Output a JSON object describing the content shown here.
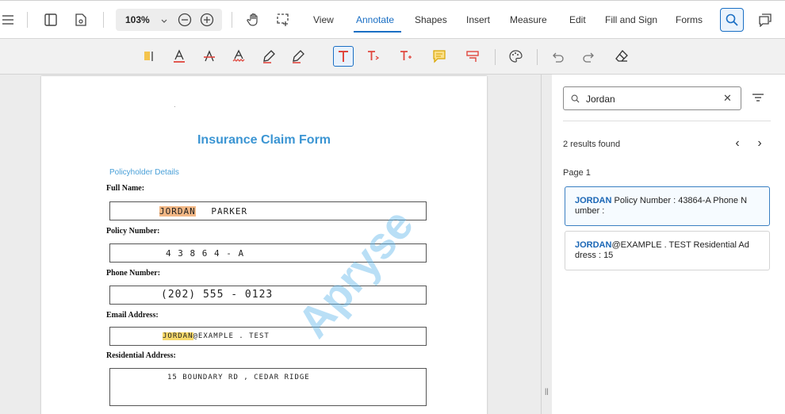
{
  "toolbar": {
    "zoom": "103%",
    "tabs": [
      {
        "label": "View"
      },
      {
        "label": "Annotate"
      },
      {
        "label": "Shapes"
      },
      {
        "label": "Insert"
      },
      {
        "label": "Measure"
      },
      {
        "label": "Edit"
      },
      {
        "label": "Fill and Sign"
      },
      {
        "label": "Forms"
      }
    ],
    "active_tab": "Annotate",
    "accent_color": "#1a6fc4"
  },
  "annotate_tools": [
    "highlight-area-icon",
    "underline-text-icon",
    "strikeout-text-icon",
    "squiggly-text-icon",
    "freehand-icon",
    "freehand-highlight-icon",
    "free-text-icon",
    "callout-icon",
    "add-text-icon",
    "note-icon",
    "link-annotation-icon",
    "style-palette-icon",
    "undo-icon",
    "redo-icon",
    "eraser-icon"
  ],
  "document": {
    "title": "Insurance Claim Form",
    "section": "Policyholder Details",
    "fields": [
      {
        "label": "Full Name:",
        "value_hl": "JORDAN",
        "value_rest": "PARKER"
      },
      {
        "label": "Policy Number:",
        "value": "4 3 8 6 4 - A"
      },
      {
        "label": "Phone Number:",
        "value": "(202)  555  - 0123"
      },
      {
        "label": "Email Address:",
        "value_hl": "JORDAN",
        "value_rest": "@EXAMPLE . TEST"
      },
      {
        "label": "Residential Address:",
        "value": "15  BOUNDARY  RD  ,  CEDAR   RIDGE"
      }
    ],
    "watermark": "Apryse"
  },
  "search_panel": {
    "query": "Jordan",
    "results_count": "2 results found",
    "page_label": "Page 1",
    "results": [
      {
        "match": "JORDAN",
        "text": " Policy Number : 43864-A Phone N umber :"
      },
      {
        "match": "JORDAN",
        "text": "@EXAMPLE . TEST Residential Ad dress : 15"
      }
    ]
  }
}
